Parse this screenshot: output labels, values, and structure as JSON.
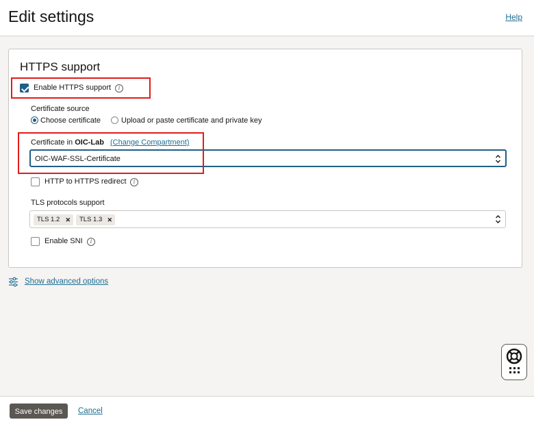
{
  "header": {
    "title": "Edit settings",
    "help_label": "Help"
  },
  "https_section": {
    "title": "HTTPS support",
    "enable_https": {
      "label": "Enable HTTPS support",
      "checked": true
    },
    "certificate_source": {
      "label": "Certificate source",
      "options": [
        {
          "label": "Choose certificate",
          "selected": true
        },
        {
          "label": "Upload or paste certificate and private key",
          "selected": false
        }
      ]
    },
    "certificate": {
      "label_prefix": "Certificate in",
      "compartment": "OIC-Lab",
      "change_compartment_label": "(Change Compartment)",
      "selected_value": "OIC-WAF-SSL-Certificate"
    },
    "http_redirect": {
      "label": "HTTP to HTTPS redirect",
      "checked": false
    },
    "tls": {
      "label": "TLS protocols support",
      "chips": [
        "TLS 1.2",
        "TLS 1.3"
      ]
    },
    "sni": {
      "label": "Enable SNI",
      "checked": false
    }
  },
  "advanced": {
    "label": "Show advanced options"
  },
  "footer": {
    "save_label": "Save changes",
    "cancel_label": "Cancel"
  },
  "colors": {
    "accent": "#1f5f86",
    "link": "#1b6d93",
    "highlight": "#e01b1b",
    "primary_button": "#5b5753"
  },
  "icons": {
    "info": "info-icon",
    "select_arrows": "up-down-arrows-icon",
    "advanced": "sliders-icon",
    "help_widget": "lifebuoy-icon"
  }
}
